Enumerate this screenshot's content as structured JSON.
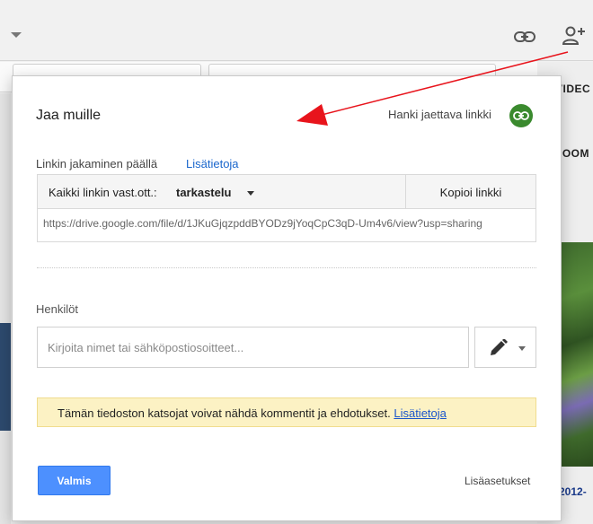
{
  "background": {
    "side_tags": [
      "VIDEC",
      "ZOOM"
    ],
    "side_year": "2012-"
  },
  "dialog": {
    "title": "Jaa muille",
    "get_shareable_link": "Hanki jaettava linkki",
    "link_sharing_status": "Linkin jakaminen päällä",
    "learn_more": "Lisätietoja",
    "access": {
      "prefix": "Kaikki linkin vast.ott.:",
      "mode": "tarkastelu"
    },
    "copy_link": "Kopioi linkki",
    "link_url": "https://drive.google.com/file/d/1JKuGjqzpddBYODz9jYoqCpC3qD-Um4v6/view?usp=sharing",
    "people_label": "Henkilöt",
    "people_placeholder": "Kirjoita nimet tai sähköpostiosoitteet...",
    "notice": {
      "text": "Tämän tiedoston katsojat voivat nähdä kommentit ja ehdotukset.",
      "link": "Lisätietoja"
    },
    "done_button": "Valmis",
    "advanced_link": "Lisäasetukset"
  },
  "icons": {
    "share_link": "link-icon",
    "add_person": "add-person-icon",
    "get_link": "link-icon",
    "permission": "pencil-icon"
  },
  "colors": {
    "primary_button": "#4d90fe",
    "link_blue": "#1a66cc",
    "link_badge": "#3a8a2e",
    "notice_bg": "#fcf2c4",
    "annotation_arrow": "#e8141c"
  }
}
